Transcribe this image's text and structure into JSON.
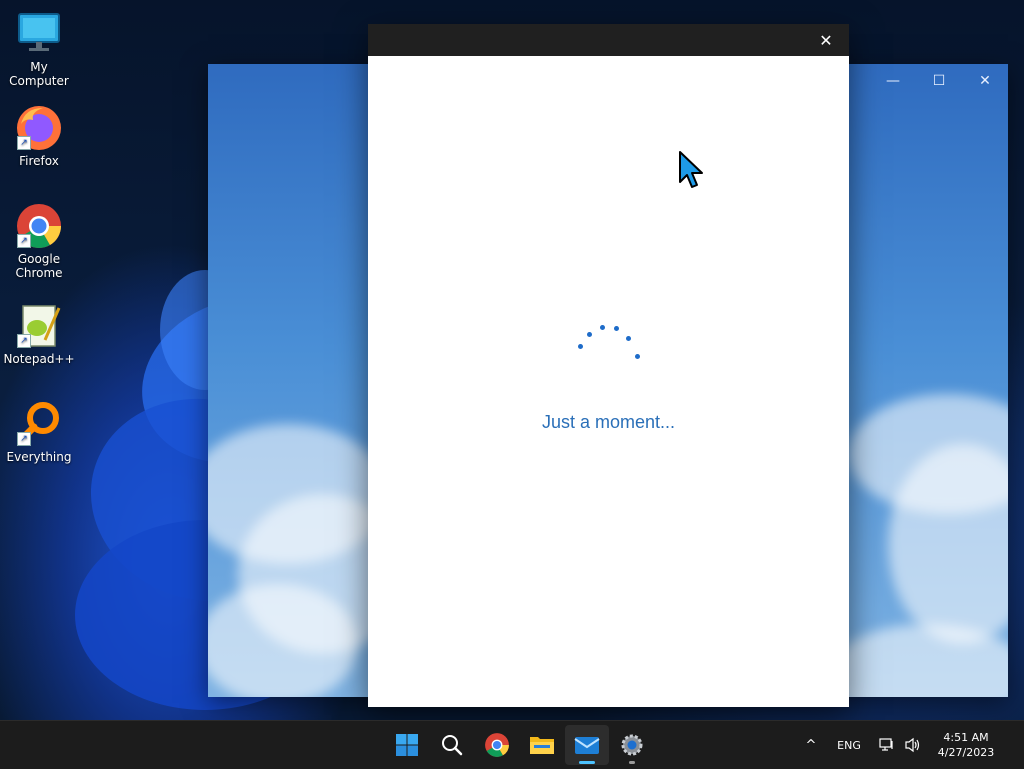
{
  "desktop": {
    "icons": [
      {
        "label": "My Computer",
        "icon": "monitor-icon"
      },
      {
        "label": "Firefox",
        "icon": "firefox-icon"
      },
      {
        "label": "Google Chrome",
        "icon": "chrome-icon"
      },
      {
        "label": "Notepad++",
        "icon": "notepadpp-icon"
      },
      {
        "label": "Everything",
        "icon": "everything-search-icon"
      }
    ]
  },
  "background_window": {
    "controls": {
      "minimize": "—",
      "maximize": "☐",
      "close": "✕"
    }
  },
  "dialog": {
    "close_glyph": "✕",
    "message": "Just a moment..."
  },
  "taskbar": {
    "items": [
      {
        "name": "start-button",
        "icon": "windows-logo-icon"
      },
      {
        "name": "search-button",
        "icon": "search-icon"
      },
      {
        "name": "chrome-taskbar-button",
        "icon": "chrome-icon"
      },
      {
        "name": "file-explorer-button",
        "icon": "folder-icon"
      },
      {
        "name": "mail-button",
        "icon": "mail-icon",
        "active": true
      },
      {
        "name": "settings-button",
        "icon": "gear-icon"
      }
    ],
    "tray": {
      "overflow_glyph": "^",
      "language": "ENG",
      "time": "4:51 AM",
      "date": "4/27/2023"
    }
  },
  "colors": {
    "accent": "#1e6cc9",
    "message_text": "#2a6fb8",
    "taskbar": "#1c1c1c",
    "active_indicator": "#4cc2ff"
  }
}
